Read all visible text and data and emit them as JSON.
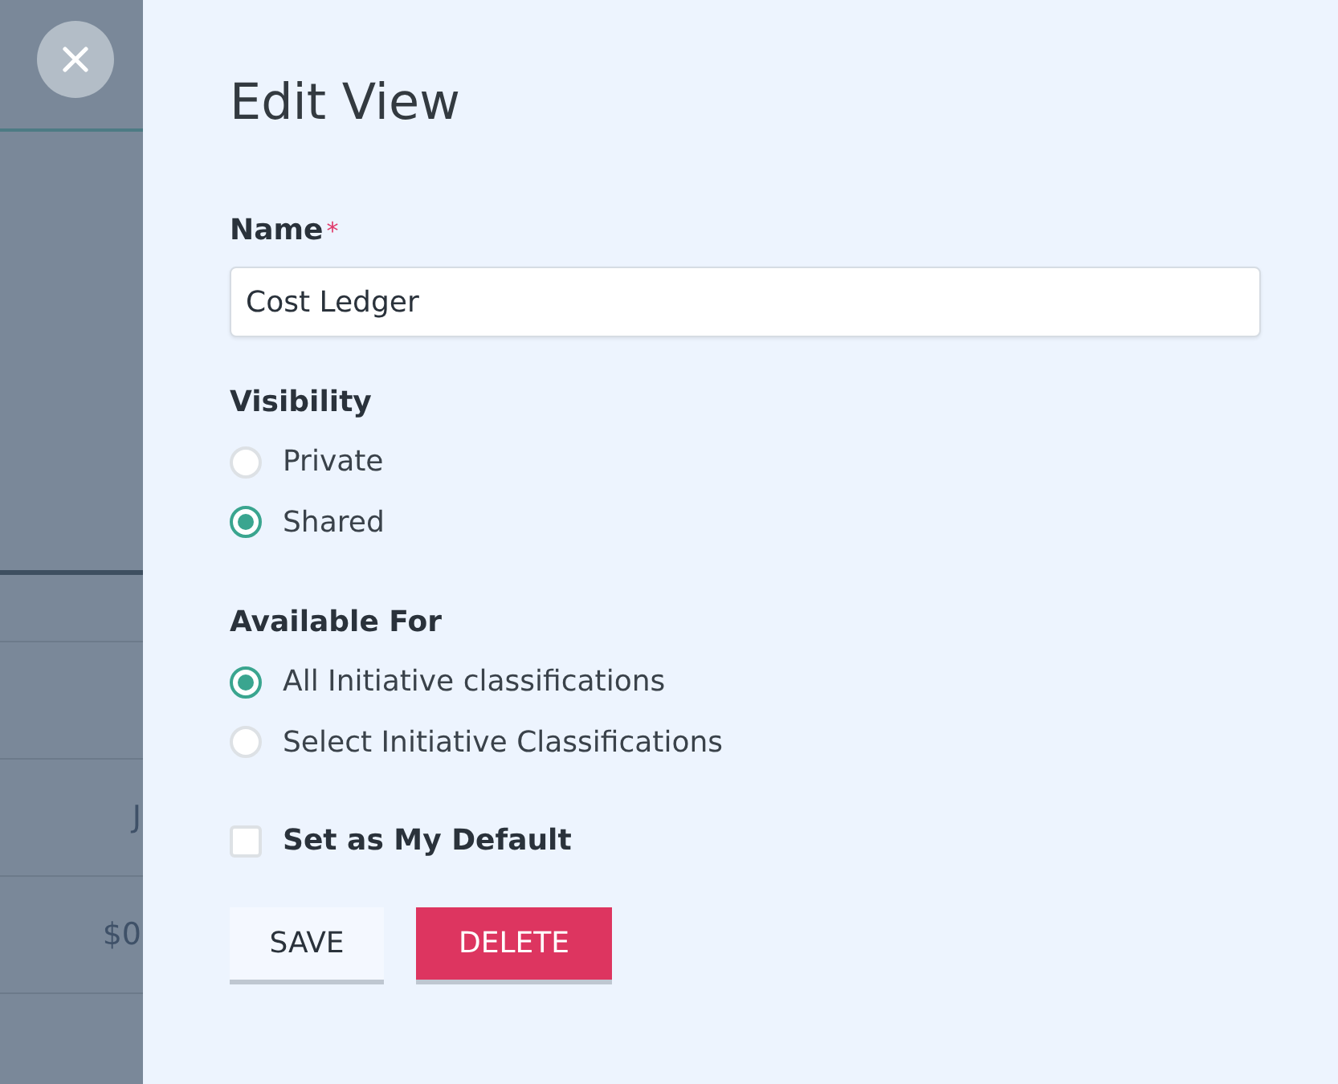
{
  "background": {
    "cells": [
      "J",
      "$0"
    ]
  },
  "panel": {
    "title": "Edit View",
    "name_field": {
      "label": "Name",
      "required_mark": "*",
      "value": "Cost Ledger"
    },
    "visibility": {
      "label": "Visibility",
      "options": [
        {
          "label": "Private",
          "selected": false
        },
        {
          "label": "Shared",
          "selected": true
        }
      ]
    },
    "available_for": {
      "label": "Available For",
      "options": [
        {
          "label": "All Initiative classifications",
          "selected": true
        },
        {
          "label": "Select Initiative Classifications",
          "selected": false
        }
      ]
    },
    "default_checkbox": {
      "label": "Set as My Default",
      "checked": false
    },
    "buttons": [
      {
        "label": "SAVE",
        "kind": "secondary"
      },
      {
        "label": "DELETE",
        "kind": "danger"
      }
    ]
  }
}
